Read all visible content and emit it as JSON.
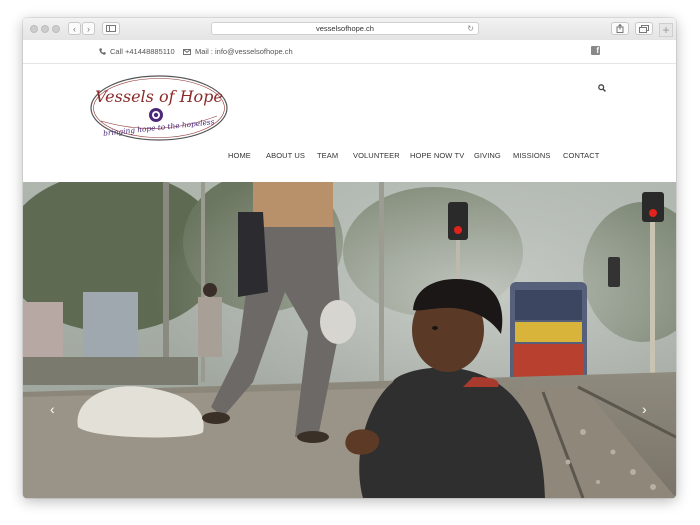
{
  "browser": {
    "url": "vesselsofhope.ch",
    "back_glyph": "‹",
    "forward_glyph": "›",
    "reload_glyph": "↻",
    "newtab_glyph": "+"
  },
  "topbar": {
    "phone": "Call +41448885110",
    "mail": "Mail : info@vesselsofhope.ch",
    "social_icon": "facebook-icon",
    "fb_glyph": "f"
  },
  "logo": {
    "title": "Vessels of Hope",
    "tagline": "bringing hope to the hopeless"
  },
  "nav": {
    "items": [
      "HOME",
      "ABOUT US",
      "TEAM",
      "VOLUNTEER",
      "HOPE NOW TV",
      "GIVING",
      "MISSIONS",
      "CONTACT"
    ]
  },
  "hero": {
    "prev_glyph": "‹",
    "next_glyph": "›"
  },
  "colors": {
    "logo_maroon": "#8b2a2a",
    "logo_purple": "#4b2a7a",
    "signal_red": "#e0231c",
    "train_yellow": "#d8b43a"
  }
}
